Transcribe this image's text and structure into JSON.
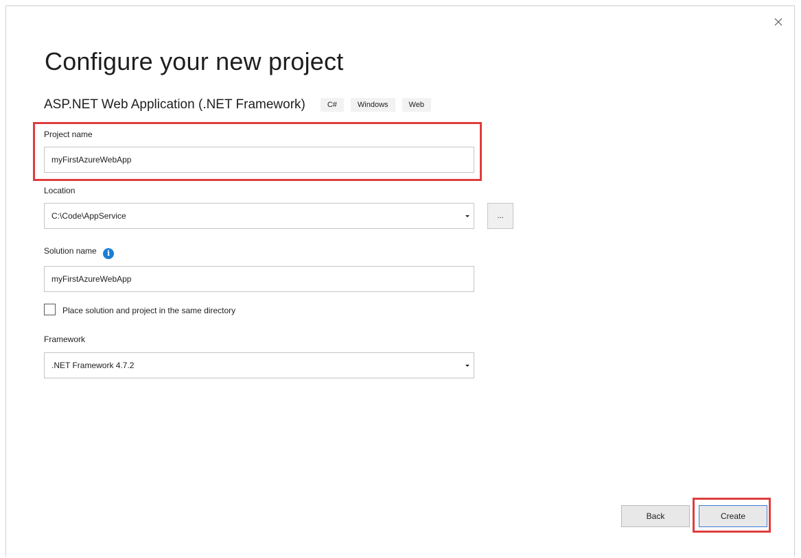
{
  "dialog": {
    "title": "Configure your new project",
    "template_name": "ASP.NET Web Application (.NET Framework)",
    "tags": [
      "C#",
      "Windows",
      "Web"
    ]
  },
  "project_name": {
    "label": "Project name",
    "value": "myFirstAzureWebApp"
  },
  "location": {
    "label": "Location",
    "value": "C:\\Code\\AppService",
    "browse_label": "..."
  },
  "solution_name": {
    "label": "Solution name",
    "info_icon": "i",
    "value": "myFirstAzureWebApp"
  },
  "same_directory": {
    "label": "Place solution and project in the same directory",
    "checked": false
  },
  "framework": {
    "label": "Framework",
    "value": ".NET Framework 4.7.2"
  },
  "buttons": {
    "back": "Back",
    "create": "Create"
  },
  "icons": {
    "close": "close-icon",
    "dropdown": "chevron-down-icon",
    "info": "info-icon"
  },
  "colors": {
    "highlight": "#e03c3c",
    "info_blue": "#1a7fd4",
    "default_button_border": "#3b7bd4"
  }
}
